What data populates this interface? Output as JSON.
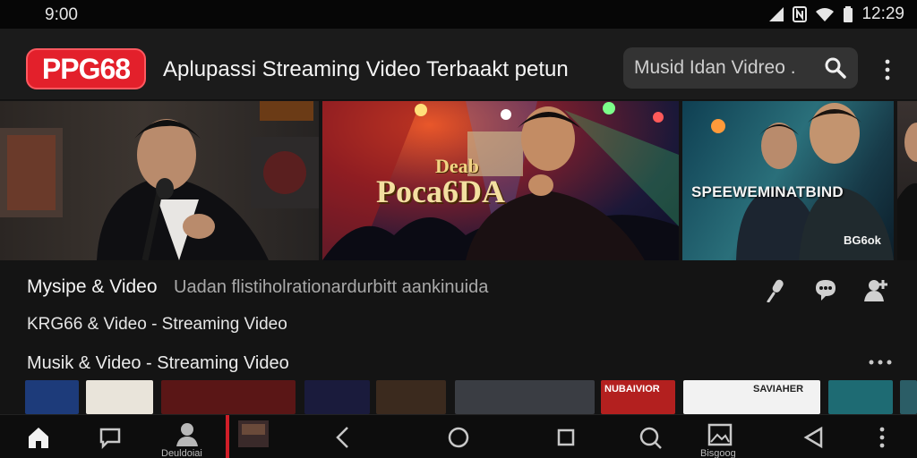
{
  "status_bar": {
    "time_left": "9:00",
    "time_right": "12:29"
  },
  "header": {
    "logo_text": "PPG68",
    "title": "Aplupassi Streaming Video Terbaakt petun",
    "search_placeholder": "Musid Idan Vidreo .",
    "brand_color": "#e3202b"
  },
  "hero": {
    "banners": [
      {
        "top_text": "",
        "main_text": ""
      },
      {
        "top_text": "Deab",
        "main_text": "Poca6DA"
      },
      {
        "top_text": "SPEEWEMINATBIND",
        "main_text": "BG6ok"
      }
    ]
  },
  "info": {
    "section_title": "Mysipe & Video",
    "section_desc": "Uadan flistiholrationardurbitt aankinuida",
    "subtitle_line": "KRG66 & Video - Streaming Video",
    "actions": [
      "microphone-icon",
      "chat-icon",
      "user-add-icon"
    ]
  },
  "row": {
    "title": "Musik & Video - Streaming Video",
    "thumbs": [
      {
        "label": "",
        "color": "#1d3b7a"
      },
      {
        "label": "",
        "color": "#e9e4da"
      },
      {
        "label": "",
        "color": "#5a1616"
      },
      {
        "label": "",
        "color": "#1a1b3c"
      },
      {
        "label": "",
        "color": "#3b2a1e"
      },
      {
        "label": "",
        "color": "#3a3d43"
      },
      {
        "label": "NUBAIVIOR",
        "color": "#b3201f"
      },
      {
        "label": "SAVIAHER",
        "color": "#f2f2f2"
      },
      {
        "label": "",
        "color": "#1e6b73"
      },
      {
        "label": "",
        "color": "#2b5d66"
      }
    ]
  },
  "bottom_nav": {
    "profile_label": "Deuldoiai",
    "gallery_label": "Bisgoog"
  }
}
